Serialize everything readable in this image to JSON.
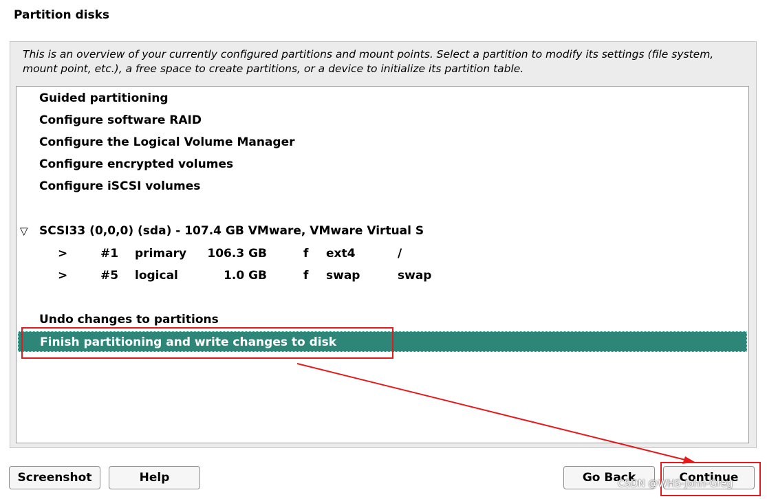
{
  "window": {
    "title": "Partition disks"
  },
  "intro_text": "This is an overview of your currently configured partitions and mount points. Select a partition to modify its settings (file system, mount point, etc.), a free space to create partitions, or a device to initialize its partition table.",
  "menu": {
    "guided": "Guided partitioning",
    "raid": "Configure software RAID",
    "lvm": "Configure the Logical Volume Manager",
    "encrypted": "Configure encrypted volumes",
    "iscsi": "Configure iSCSI volumes"
  },
  "disk": {
    "toggle_glyph": "▽",
    "label": "SCSI33 (0,0,0) (sda) - 107.4 GB VMware, VMware Virtual S",
    "partitions": [
      {
        "arrow": ">",
        "number": "#1",
        "type": "primary",
        "size": "106.3 GB",
        "flag": "f",
        "fs": "ext4",
        "mount": "/"
      },
      {
        "arrow": ">",
        "number": "#5",
        "type": "logical",
        "size": "1.0 GB",
        "flag": "f",
        "fs": "swap",
        "mount": "swap"
      }
    ]
  },
  "actions": {
    "undo": "Undo changes to partitions",
    "finish": "Finish partitioning and write changes to disk"
  },
  "buttons": {
    "screenshot": "Screenshot",
    "help": "Help",
    "go_back": "Go Back",
    "continue": "Continue"
  },
  "watermark": "CSDN @WHS-John-Greg",
  "colors": {
    "selection": "#2e8679",
    "annotation": "#e61a1a"
  }
}
